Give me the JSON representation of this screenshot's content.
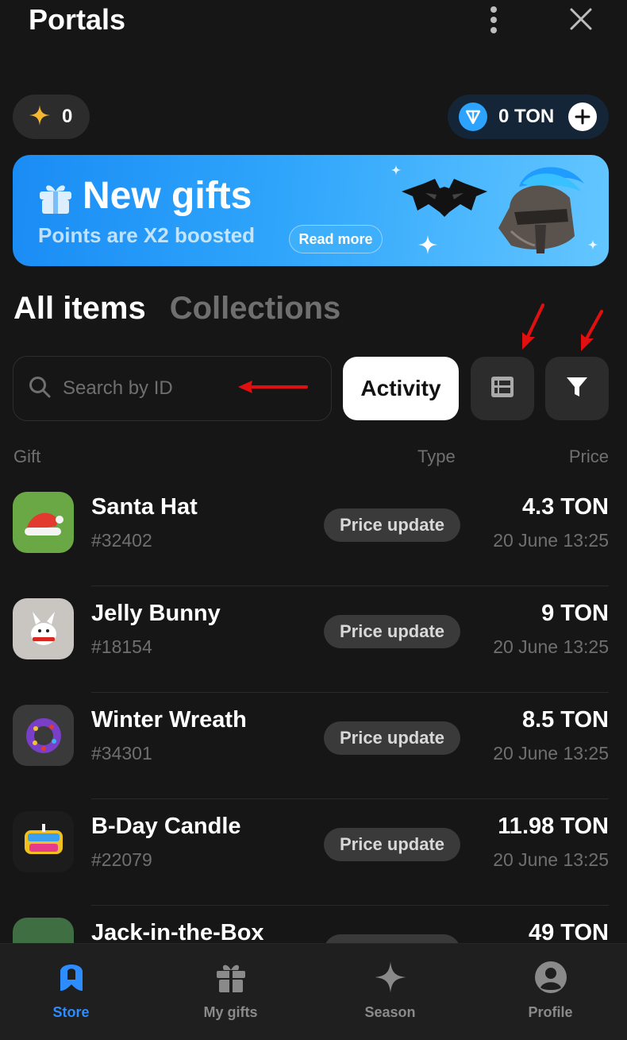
{
  "header": {
    "title": "Portals"
  },
  "wallet": {
    "points": "0",
    "balance": "0 TON"
  },
  "banner": {
    "title": "New gifts",
    "subtitle": "Points are X2 boosted",
    "cta": "Read more"
  },
  "tabs": [
    {
      "label": "All items",
      "active": true
    },
    {
      "label": "Collections",
      "active": false
    }
  ],
  "search": {
    "placeholder": "Search by ID",
    "value": ""
  },
  "toolbar": {
    "activity_label": "Activity"
  },
  "columns": {
    "gift": "Gift",
    "type": "Type",
    "price": "Price"
  },
  "items": [
    {
      "name": "Santa Hat",
      "id": "#32402",
      "type": "Price update",
      "price": "4.3 TON",
      "date": "20 June 13:25"
    },
    {
      "name": "Jelly Bunny",
      "id": "#18154",
      "type": "Price update",
      "price": "9 TON",
      "date": "20 June 13:25"
    },
    {
      "name": "Winter Wreath",
      "id": "#34301",
      "type": "Price update",
      "price": "8.5 TON",
      "date": "20 June 13:25"
    },
    {
      "name": "B-Day Candle",
      "id": "#22079",
      "type": "Price update",
      "price": "11.98 TON",
      "date": "20 June 13:25"
    },
    {
      "name": "Jack-in-the-Box",
      "id": "",
      "type": "Price update",
      "price": "49 TON",
      "date": ""
    }
  ],
  "nav": [
    {
      "label": "Store",
      "icon": "store-icon",
      "active": true
    },
    {
      "label": "My gifts",
      "icon": "gift-icon",
      "active": false
    },
    {
      "label": "Season",
      "icon": "sparkle-icon",
      "active": false
    },
    {
      "label": "Profile",
      "icon": "profile-icon",
      "active": false
    }
  ],
  "colors": {
    "accent": "#2d8cff",
    "background": "#161616",
    "annotation": "#e01010",
    "ton": "#2ba3ff",
    "star": "#f5b731"
  }
}
